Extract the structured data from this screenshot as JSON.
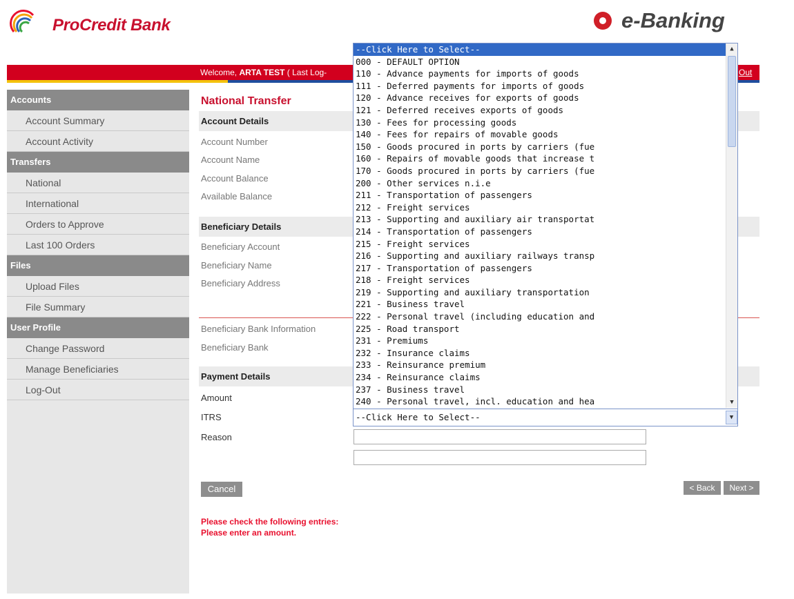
{
  "header": {
    "bank_name": "ProCredit Bank",
    "product_name": "e-Banking"
  },
  "topbar": {
    "welcome_prefix": "Welcome, ",
    "user_name": "ARTA TEST",
    "last_login_fragment": " ( Last Log-",
    "logout_fragment": "Out"
  },
  "sidebar": {
    "sections": [
      {
        "title": "Accounts",
        "items": [
          "Account Summary",
          "Account Activity"
        ]
      },
      {
        "title": "Transfers",
        "items": [
          "National",
          "International",
          "Orders to Approve",
          "Last 100 Orders"
        ]
      },
      {
        "title": "Files",
        "items": [
          "Upload Files",
          "File Summary"
        ]
      },
      {
        "title": "User Profile",
        "items": [
          "Change Password",
          "Manage Beneficiaries",
          "Log-Out"
        ]
      }
    ]
  },
  "main": {
    "page_title": "National Transfer",
    "account_details": {
      "heading": "Account Details",
      "labels": [
        "Account Number",
        "Account Name",
        "Account Balance",
        "Available Balance"
      ]
    },
    "beneficiary_details": {
      "heading": "Beneficiary Details",
      "labels": [
        "Beneficiary Account",
        "Beneficiary Name",
        "Beneficiary Address"
      ]
    },
    "bank_info": {
      "heading": "Beneficiary Bank Information",
      "labels": [
        "Beneficiary Bank"
      ]
    },
    "payment_details": {
      "heading": "Payment Details",
      "labels": [
        "Amount",
        "ITRS",
        "Reason"
      ],
      "reason_line1": "",
      "reason_line2": ""
    },
    "buttons": {
      "cancel": "Cancel",
      "back": "< Back",
      "next": "Next >"
    },
    "errors": {
      "title": "Please check the following entries:",
      "message": "Please enter an amount."
    }
  },
  "itrs_dropdown": {
    "selected": "--Click Here to Select--",
    "options": [
      "--Click Here to Select--",
      "000 - DEFAULT OPTION",
      "110 - Advance payments for imports of goods",
      "111 - Deferred payments for imports of goods",
      "120 - Advance receives for exports of goods",
      "121 - Deferred receives exports of goods",
      "130 - Fees for processing goods",
      "140 - Fees for repairs of movable goods",
      "150 - Goods procured in ports by carriers (fue",
      "160 - Repairs of movable goods that increase t",
      "170 - Goods procured in ports by carriers (fue",
      "200 - Other services n.i.e",
      "211 - Transportation of passengers",
      "212 - Freight services",
      "213 - Supporting and auxiliary air transportat",
      "214 - Transportation of passengers",
      "215 - Freight services",
      "216 - Supporting and auxiliary railways transp",
      "217 - Transportation of passengers",
      "218 - Freight services",
      "219 - Supporting and auxiliary transportation",
      "221 - Business travel",
      "222 - Personal travel (including education and",
      "225 - Road transport",
      "231 - Premiums",
      "232 - Insurance claims",
      "233 - Reinsurance premium",
      "234 - Reinsurance claims",
      "237 - Business travel",
      "240 - Personal travel, incl. education and hea"
    ]
  },
  "colors": {
    "brand_red": "#c8102e",
    "bar_red": "#d2001e",
    "stripe_yellow": "#f4c20d",
    "stripe_blue": "#1f4e9e",
    "selection_blue": "#3169c6",
    "sidebar_head": "#8a8a8a"
  }
}
